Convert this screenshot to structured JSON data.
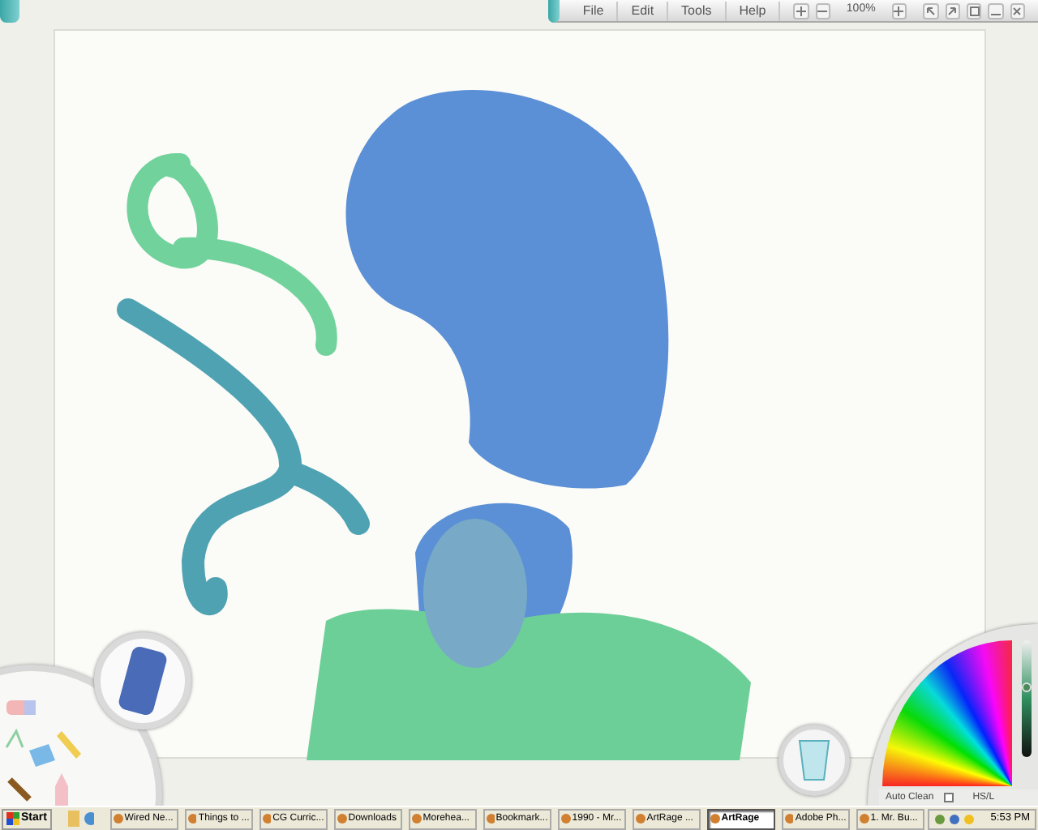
{
  "menu_bar": {
    "items": [
      {
        "label": "File"
      },
      {
        "label": "Edit"
      },
      {
        "label": "Tools"
      },
      {
        "label": "Help"
      }
    ],
    "zoom": "100%"
  },
  "color_picker": {
    "auto_clean": {
      "label": "Auto Clean",
      "checked": false
    },
    "mode": "HS/L",
    "luminance": {
      "level": 0.6
    }
  },
  "taskbar": {
    "start": "Start",
    "tasks": [
      {
        "label": "Wired Ne...",
        "selected": false
      },
      {
        "label": "Things to ...",
        "selected": false
      },
      {
        "label": "CG Curric...",
        "selected": false
      },
      {
        "label": "Downloads",
        "selected": false
      },
      {
        "label": "Morehea...",
        "selected": false
      },
      {
        "label": "Bookmark...",
        "selected": false
      },
      {
        "label": "1990 - Mr...",
        "selected": false
      },
      {
        "label": "ArtRage ...",
        "selected": false
      },
      {
        "label": "ArtRage",
        "selected": true
      },
      {
        "label": "Adobe Ph...",
        "selected": false
      },
      {
        "label": "1. Mr. Bu...",
        "selected": false
      }
    ],
    "clock": "5:53 PM"
  }
}
